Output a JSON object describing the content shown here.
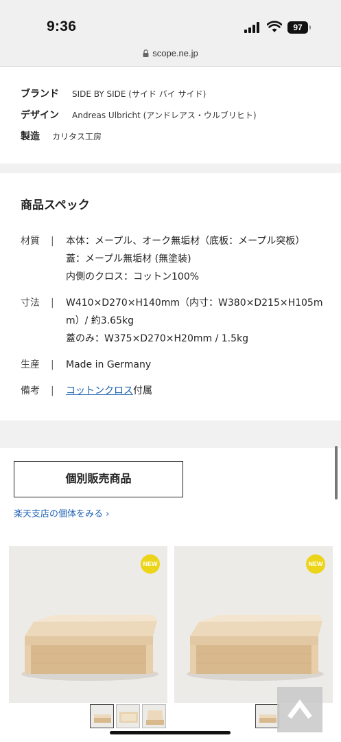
{
  "status": {
    "time": "9:36",
    "battery": "97"
  },
  "browser": {
    "url": "scope.ne.jp"
  },
  "credits": [
    {
      "key": "ブランド",
      "value": "SIDE BY SIDE (サイド バイ サイド)"
    },
    {
      "key": "デザイン",
      "value": "Andreas Ulbricht (アンドレアス・ウルブリヒト)"
    },
    {
      "key": "製造",
      "value": "カリタス工房"
    }
  ],
  "spec": {
    "title": "商品スペック",
    "rows": [
      {
        "label": "材質",
        "sep": "|",
        "lines": [
          "本体：メープル、オーク無垢材（底板：メープル突板）",
          "蓋：メープル無垢材 (無塗装)",
          "内側のクロス：コットン100%"
        ]
      },
      {
        "label": "寸法",
        "sep": "|",
        "lines": [
          "W410×D270×H140mm（内寸：W380×D215×H105m",
          "m）/ 約3.65kg",
          "蓋のみ：W375×D270×H20mm / 1.5kg"
        ]
      },
      {
        "label": "生産",
        "sep": "|",
        "lines": [
          "Made in Germany"
        ]
      },
      {
        "label": "備考",
        "sep": "|",
        "link": "コットンクロス",
        "suffix": "付属"
      }
    ]
  },
  "individual": {
    "button_label": "個別販売商品",
    "rakuten_link": "楽天支店の個体をみる ›"
  },
  "products": [
    {
      "badge": "NEW"
    },
    {
      "badge": "NEW"
    }
  ],
  "colors": {
    "link": "#1a5fb4",
    "badge": "#ecd419",
    "section_gap": "#f1f1f1"
  },
  "icons": [
    "signal-icon",
    "wifi-icon",
    "battery-icon",
    "lock-icon",
    "back-to-top-icon"
  ]
}
